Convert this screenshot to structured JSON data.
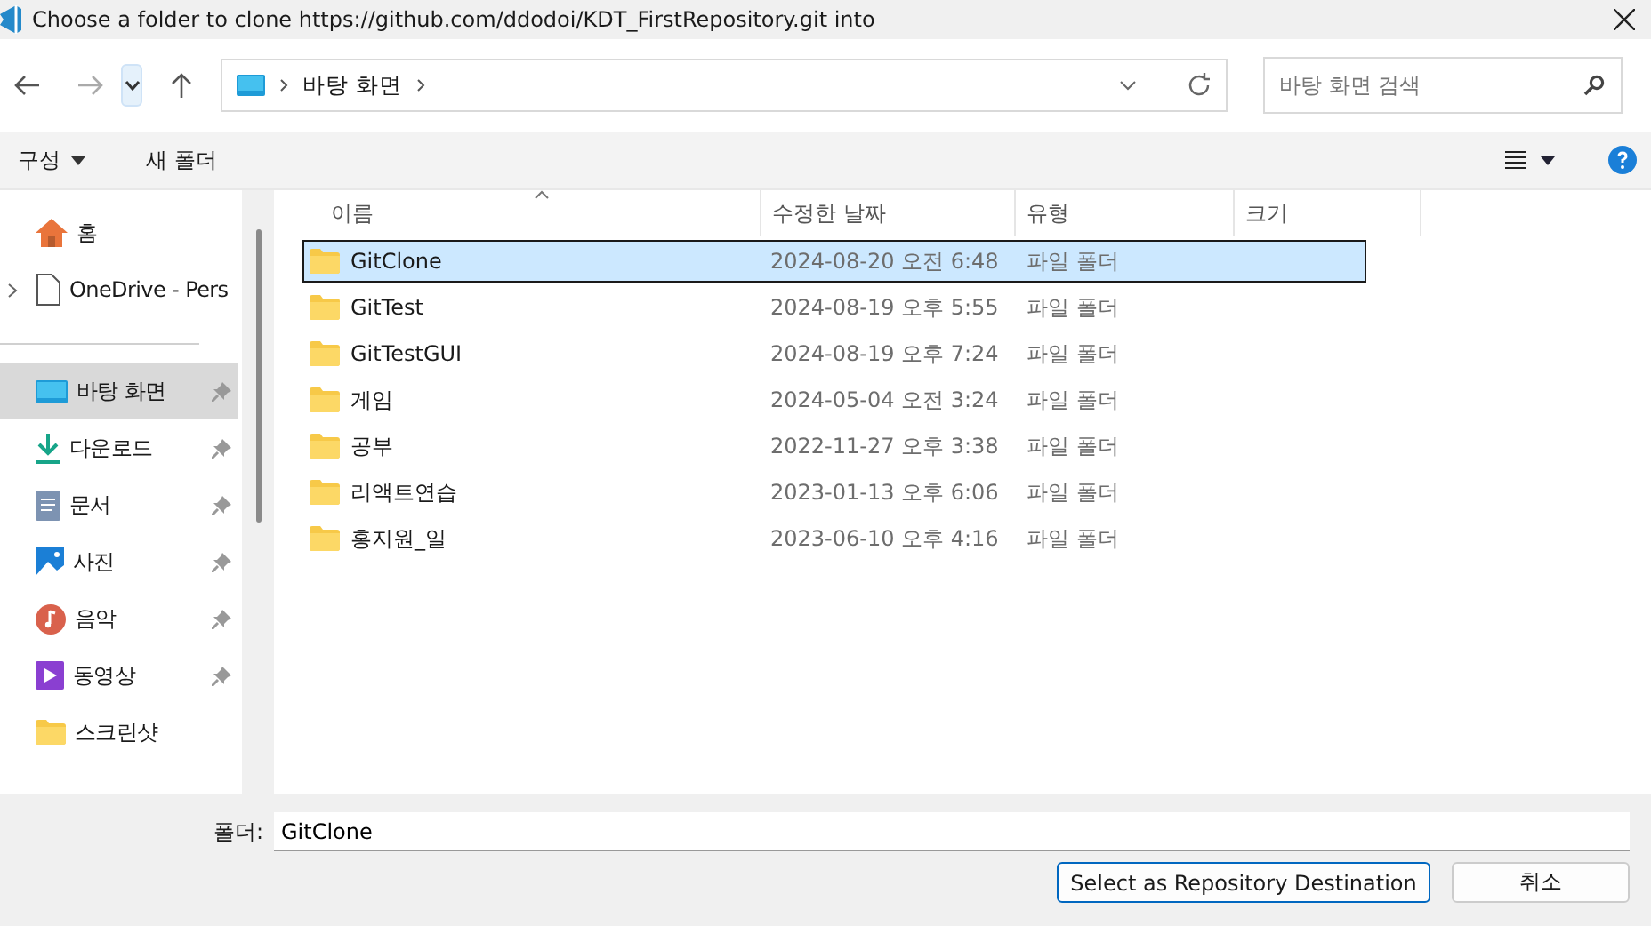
{
  "window": {
    "title": "Choose a folder to clone https://github.com/ddodoi/KDT_FirstRepository.git into"
  },
  "address_bar": {
    "path": [
      "바탕 화면"
    ]
  },
  "search": {
    "placeholder": "바탕 화면 검색"
  },
  "toolbar": {
    "organize": "구성",
    "new_folder": "새 폴더"
  },
  "sidebar": {
    "items": [
      {
        "kind": "home",
        "label": "홈",
        "pinned": false,
        "selected": false
      },
      {
        "kind": "cloud",
        "label": "OneDrive - Pers",
        "pinned": false,
        "selected": false,
        "expandable": true
      },
      {
        "kind": "divider"
      },
      {
        "kind": "desktop",
        "label": "바탕 화면",
        "pinned": true,
        "selected": true
      },
      {
        "kind": "download",
        "label": "다운로드",
        "pinned": true,
        "selected": false
      },
      {
        "kind": "documents",
        "label": "문서",
        "pinned": true,
        "selected": false
      },
      {
        "kind": "pictures",
        "label": "사진",
        "pinned": true,
        "selected": false
      },
      {
        "kind": "music",
        "label": "음악",
        "pinned": true,
        "selected": false
      },
      {
        "kind": "video",
        "label": "동영상",
        "pinned": true,
        "selected": false
      },
      {
        "kind": "folder",
        "label": "스크린샷",
        "pinned": false,
        "selected": false
      }
    ]
  },
  "table": {
    "columns": [
      "이름",
      "수정한 날짜",
      "유형",
      "크기"
    ],
    "rows": [
      {
        "name": "GitClone",
        "modified": "2024-08-20 오전 6:48",
        "type": "파일 폴더",
        "selected": true
      },
      {
        "name": "GitTest",
        "modified": "2024-08-19 오후 5:55",
        "type": "파일 폴더",
        "selected": false
      },
      {
        "name": "GitTestGUI",
        "modified": "2024-08-19 오후 7:24",
        "type": "파일 폴더",
        "selected": false
      },
      {
        "name": "게임",
        "modified": "2024-05-04 오전 3:24",
        "type": "파일 폴더",
        "selected": false
      },
      {
        "name": "공부",
        "modified": "2022-11-27 오후 3:38",
        "type": "파일 폴더",
        "selected": false
      },
      {
        "name": "리액트연습",
        "modified": "2023-01-13 오후 6:06",
        "type": "파일 폴더",
        "selected": false
      },
      {
        "name": "홍지원_일",
        "modified": "2023-06-10 오후 4:16",
        "type": "파일 폴더",
        "selected": false
      }
    ]
  },
  "footer": {
    "folder_label": "폴더:",
    "folder_value": "GitClone",
    "buttons": [
      "Select as Repository Destination",
      "취소"
    ]
  }
}
